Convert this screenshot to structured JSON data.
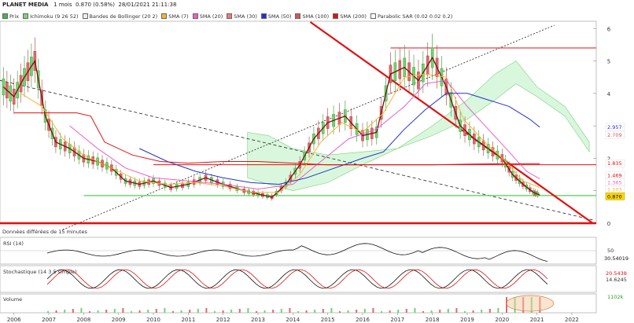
{
  "header": {
    "title": "PLANET MEDIA",
    "period": "1 mois",
    "quote": "0.870 (0.58%)",
    "datetime": "28/01/2021 21:11:38"
  },
  "legend": [
    {
      "label": "Prix",
      "color": "#4caf50"
    },
    {
      "label": "Ichimoku (9 26 52)",
      "color": "#7fd07f"
    },
    {
      "label": "Bandes de Bollinger (20 2)",
      "color": "#eeeeee"
    },
    {
      "label": "SMA (7)",
      "color": "#f6b532"
    },
    {
      "label": "SMA (20)",
      "color": "#ec5ecb"
    },
    {
      "label": "SMA (30)",
      "color": "#f07a78"
    },
    {
      "label": "SMA (50)",
      "color": "#2233cc"
    },
    {
      "label": "SMA (100)",
      "color": "#d95353"
    },
    {
      "label": "SMA (200)",
      "color": "#e01111"
    },
    {
      "label": "Parabolic SAR (0.02 0.02 0.2)",
      "color": "#ffffff"
    }
  ],
  "notes": {
    "delayed": "Données différées de 15 minutes"
  },
  "panels": {
    "rsi": {
      "label": "RSI (14)",
      "value_tag": "30.54019",
      "level": "50"
    },
    "stoch": {
      "label": "Stochastique (14 3 5 simple)",
      "value_tag": "20.5438",
      "value_tag2": "14.6245"
    },
    "volume": {
      "label": "Volume",
      "value_tag": "1102k"
    }
  },
  "colors": {
    "price_tag": "#ffd700",
    "red_line": "#e01111",
    "green_line": "#22cc22",
    "blue_tag": "#2233cc"
  },
  "chart_data": {
    "type": "line",
    "title": "PLANET MEDIA",
    "x_ticks": [
      "2006",
      "2007",
      "2008",
      "2009",
      "2010",
      "2011",
      "2012",
      "2013",
      "2014",
      "2015",
      "2016",
      "2017",
      "2018",
      "2019",
      "2020",
      "2021",
      "2022"
    ],
    "y_ticks": [
      "6",
      "5",
      "4",
      "3",
      "2",
      "1",
      "0"
    ],
    "ylim": [
      0,
      6.2
    ],
    "y_scale": "linear",
    "price_tags": [
      {
        "label": "2.957",
        "value": 2.957,
        "color": "#2233cc"
      },
      {
        "label": "2.709",
        "value": 2.709,
        "color": "#d95353"
      },
      {
        "label": "1.835",
        "value": 1.835,
        "color": "#e01111"
      },
      {
        "label": "1.469",
        "value": 1.469,
        "color": "#e01111"
      },
      {
        "label": "1.365",
        "value": 1.365,
        "color": "#ec5ecb"
      },
      {
        "label": "1.103",
        "value": 1.103,
        "color": "#f6b532"
      },
      {
        "label": "0.870",
        "value": 0.87,
        "color": "#ffd700"
      }
    ],
    "horizontal_levels": [
      {
        "value": 5.4,
        "color": "#e01111"
      },
      {
        "value": 1.8,
        "color": "#e01111"
      },
      {
        "value": 0.85,
        "color": "#22cc22"
      },
      {
        "value": 0.0,
        "color": "#e01111"
      }
    ],
    "series": [
      {
        "name": "Prix",
        "values": [
          [
            2005.7,
            4.2
          ],
          [
            2006.0,
            3.9
          ],
          [
            2006.3,
            4.5
          ],
          [
            2006.6,
            5.0
          ],
          [
            2006.9,
            3.3
          ],
          [
            2007.2,
            2.5
          ],
          [
            2007.6,
            2.3
          ],
          [
            2008.0,
            2.0
          ],
          [
            2008.4,
            1.9
          ],
          [
            2008.8,
            1.7
          ],
          [
            2009.2,
            1.3
          ],
          [
            2009.6,
            1.2
          ],
          [
            2010.0,
            1.3
          ],
          [
            2010.5,
            1.1
          ],
          [
            2011.0,
            1.2
          ],
          [
            2011.5,
            1.4
          ],
          [
            2012.0,
            1.2
          ],
          [
            2012.6,
            1.0
          ],
          [
            2013.0,
            0.9
          ],
          [
            2013.4,
            0.8
          ],
          [
            2013.8,
            1.2
          ],
          [
            2014.2,
            1.8
          ],
          [
            2014.6,
            2.6
          ],
          [
            2015.0,
            3.1
          ],
          [
            2015.5,
            3.3
          ],
          [
            2016.0,
            2.7
          ],
          [
            2016.4,
            2.8
          ],
          [
            2016.8,
            4.6
          ],
          [
            2017.2,
            4.8
          ],
          [
            2017.6,
            4.4
          ],
          [
            2018.0,
            5.1
          ],
          [
            2018.4,
            4.2
          ],
          [
            2018.8,
            3.0
          ],
          [
            2019.2,
            2.6
          ],
          [
            2019.6,
            2.3
          ],
          [
            2020.0,
            2.0
          ],
          [
            2020.3,
            1.5
          ],
          [
            2020.6,
            1.2
          ],
          [
            2020.9,
            0.95
          ],
          [
            2021.08,
            0.87
          ]
        ]
      },
      {
        "name": "SMA (7)",
        "values": [
          [
            2006.2,
            4.0
          ],
          [
            2006.8,
            3.6
          ],
          [
            2007.4,
            2.6
          ],
          [
            2008.0,
            2.1
          ],
          [
            2008.8,
            1.7
          ],
          [
            2009.6,
            1.3
          ],
          [
            2010.4,
            1.2
          ],
          [
            2011.2,
            1.25
          ],
          [
            2012.0,
            1.15
          ],
          [
            2012.8,
            0.95
          ],
          [
            2013.6,
            0.95
          ],
          [
            2014.2,
            1.5
          ],
          [
            2014.8,
            2.5
          ],
          [
            2015.4,
            3.1
          ],
          [
            2016.0,
            2.8
          ],
          [
            2016.6,
            3.4
          ],
          [
            2017.2,
            4.5
          ],
          [
            2017.8,
            4.6
          ],
          [
            2018.4,
            4.5
          ],
          [
            2018.9,
            3.2
          ],
          [
            2019.5,
            2.5
          ],
          [
            2020.1,
            1.9
          ],
          [
            2020.6,
            1.3
          ],
          [
            2021.08,
            1.103
          ]
        ]
      },
      {
        "name": "SMA (20)",
        "values": [
          [
            2007.6,
            3.0
          ],
          [
            2008.4,
            2.3
          ],
          [
            2009.2,
            1.7
          ],
          [
            2010.0,
            1.4
          ],
          [
            2011.0,
            1.3
          ],
          [
            2012.0,
            1.2
          ],
          [
            2013.0,
            1.05
          ],
          [
            2014.0,
            1.2
          ],
          [
            2014.8,
            1.9
          ],
          [
            2015.6,
            2.6
          ],
          [
            2016.4,
            2.9
          ],
          [
            2017.2,
            3.6
          ],
          [
            2017.8,
            4.3
          ],
          [
            2018.4,
            4.4
          ],
          [
            2019.0,
            3.6
          ],
          [
            2019.6,
            2.9
          ],
          [
            2020.2,
            2.2
          ],
          [
            2020.7,
            1.6
          ],
          [
            2021.08,
            1.365
          ]
        ]
      },
      {
        "name": "SMA (50)",
        "values": [
          [
            2009.6,
            2.3
          ],
          [
            2010.4,
            1.9
          ],
          [
            2011.2,
            1.6
          ],
          [
            2012.0,
            1.4
          ],
          [
            2012.8,
            1.25
          ],
          [
            2013.6,
            1.2
          ],
          [
            2014.4,
            1.4
          ],
          [
            2015.2,
            1.7
          ],
          [
            2016.0,
            2.0
          ],
          [
            2016.6,
            2.2
          ],
          [
            2017.2,
            2.9
          ],
          [
            2017.8,
            3.5
          ],
          [
            2018.4,
            4.0
          ],
          [
            2019.0,
            4.0
          ],
          [
            2019.6,
            3.8
          ],
          [
            2020.2,
            3.6
          ],
          [
            2020.8,
            3.2
          ],
          [
            2021.08,
            2.957
          ]
        ]
      },
      {
        "name": "SMA (200)",
        "values": [
          [
            2006.0,
            3.4
          ],
          [
            2007.8,
            3.4
          ],
          [
            2008.2,
            3.3
          ],
          [
            2008.6,
            2.5
          ],
          [
            2009.4,
            2.1
          ],
          [
            2010.2,
            1.9
          ],
          [
            2011.0,
            1.85
          ],
          [
            2012.0,
            1.9
          ],
          [
            2013.0,
            1.9
          ],
          [
            2014.0,
            1.85
          ],
          [
            2015.0,
            1.8
          ],
          [
            2016.0,
            1.8
          ],
          [
            2017.0,
            1.8
          ],
          [
            2018.0,
            1.8
          ],
          [
            2019.0,
            1.82
          ],
          [
            2020.0,
            1.83
          ],
          [
            2021.08,
            1.835
          ]
        ]
      }
    ],
    "indicators": {
      "rsi_last": 30.54019,
      "stoch_last": [
        20.5438,
        14.6245
      ],
      "volume_last": "1102k"
    }
  }
}
